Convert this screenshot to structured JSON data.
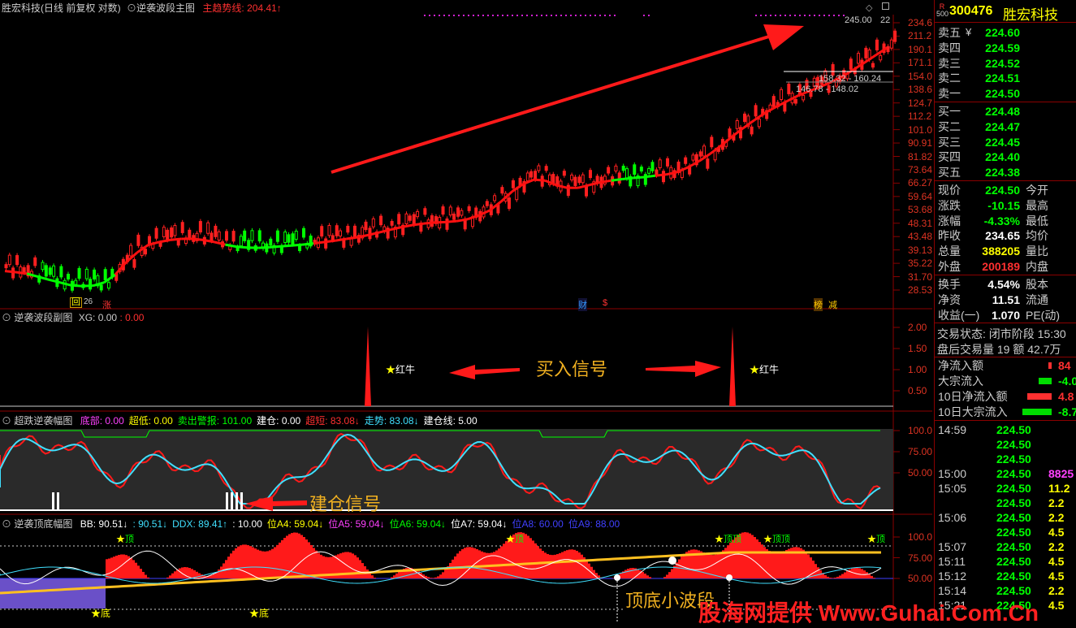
{
  "main": {
    "stock_name": "胜宏科技",
    "period": "(日线 前复权 对数)",
    "indicator": "逆袭波段主图",
    "trend_label": "主趋势线:",
    "trend_value": "204.41",
    "high_price": "245.00",
    "right_top_label": "22",
    "range_labels": [
      "158.32 - 160.24",
      "146.78 - 148.02"
    ],
    "y_ticks": [
      "234.6",
      "211.2",
      "190.1",
      "171.1",
      "154.0",
      "138.6",
      "124.7",
      "112.2",
      "101.0",
      "90.91",
      "81.82",
      "73.64",
      "66.27",
      "59.64",
      "53.68",
      "48.31",
      "43.48",
      "39.13",
      "35.22",
      "31.70",
      "28.53"
    ],
    "event_markers": [
      "回",
      "26",
      "涨",
      "财",
      "$",
      "榜",
      "减"
    ]
  },
  "sub1": {
    "title": "逆袭波段副图",
    "xg_label": "XG: 0.00",
    "xg_value": ": 0.00",
    "signal_label": "红牛",
    "annotation": "买入信号",
    "y_ticks": [
      "2.00",
      "1.50",
      "1.00",
      "0.50"
    ]
  },
  "sub2": {
    "title": "超跌逆袭幅图",
    "legend": [
      {
        "text": "底部: 0.00",
        "color": "#ff40ff"
      },
      {
        "text": "超低: 0.00",
        "color": "#ffff00"
      },
      {
        "text": "卖出警报: 101.00",
        "color": "#00ff00"
      },
      {
        "text": "建仓: 0.00",
        "color": "#ffffff"
      },
      {
        "text": "超短: 83.08↓",
        "color": "#ff3030"
      },
      {
        "text": "走势: 83.08↓",
        "color": "#40e0ff"
      },
      {
        "text": "建仓线: 5.00",
        "color": "#ffffff"
      }
    ],
    "annotation": "建仓信号",
    "y_ticks": [
      "100.0",
      "75.00",
      "50.00"
    ]
  },
  "sub3": {
    "title": "逆袭顶底幅图",
    "legend": [
      {
        "text": "BB: 90.51↓",
        "color": "#ffffff"
      },
      {
        "text": ": 90.51↓",
        "color": "#40e0ff"
      },
      {
        "text": "DDX: 89.41↑",
        "color": "#40e0ff"
      },
      {
        "text": ": 10.00",
        "color": "#ffffff"
      },
      {
        "text": "位A4: 59.04↓",
        "color": "#ffff00"
      },
      {
        "text": "位A5: 59.04↓",
        "color": "#ff40ff"
      },
      {
        "text": "位A6: 59.04↓",
        "color": "#00ff00"
      },
      {
        "text": "位A7: 59.04↓",
        "color": "#ffffff"
      },
      {
        "text": "位A8: 60.00",
        "color": "#4040ff"
      },
      {
        "text": "位A9: 88.00",
        "color": "#4040ff"
      }
    ],
    "labels_top": [
      "顶",
      "顶",
      "顶顶",
      "顶顶",
      "顶"
    ],
    "labels_bottom": [
      "底",
      "底"
    ],
    "annotation": "顶底小波段",
    "y_ticks": [
      "100.0",
      "75.00",
      "50.00"
    ]
  },
  "watermark": "股海网提供 Www.Guhai.Com.Cn",
  "panel": {
    "r_badge": "R",
    "r_num": "500",
    "code": "300476",
    "name": "胜宏科技",
    "asks": [
      {
        "label": "卖五",
        "price": "224.60"
      },
      {
        "label": "卖四",
        "price": "224.59"
      },
      {
        "label": "卖三",
        "price": "224.52"
      },
      {
        "label": "卖二",
        "price": "224.51"
      },
      {
        "label": "卖一",
        "price": "224.50"
      }
    ],
    "ask_unit": "¥",
    "bids": [
      {
        "label": "买一",
        "price": "224.48"
      },
      {
        "label": "买二",
        "price": "224.47"
      },
      {
        "label": "买三",
        "price": "224.45"
      },
      {
        "label": "买四",
        "price": "224.40"
      },
      {
        "label": "买五",
        "price": "224.38"
      }
    ],
    "stats": [
      {
        "l": "现价",
        "v": "224.50",
        "vc": "#00ff00",
        "r": "今开"
      },
      {
        "l": "涨跌",
        "v": "-10.15",
        "vc": "#00ff00",
        "r": "最高"
      },
      {
        "l": "涨幅",
        "v": "-4.33%",
        "vc": "#00ff00",
        "r": "最低"
      },
      {
        "l": "昨收",
        "v": "234.65",
        "vc": "#ffffff",
        "r": "均价"
      },
      {
        "l": "总量",
        "v": "388205",
        "vc": "#ffff00",
        "r": "量比"
      },
      {
        "l": "外盘",
        "v": "200189",
        "vc": "#ff3030",
        "r": "内盘"
      }
    ],
    "stats2": [
      {
        "l": "换手",
        "v": "4.54%",
        "vc": "#ffffff",
        "r": "股本"
      },
      {
        "l": "净资",
        "v": "11.51",
        "vc": "#ffffff",
        "r": "流通"
      },
      {
        "l": "收益(一)",
        "v": "1.070",
        "vc": "#ffffff",
        "r": "PE(动)"
      }
    ],
    "trade_status": "交易状态: 闭市阶段 15:30",
    "after_volume": "盘后交易量 19 额 42.7万",
    "flows": [
      {
        "l": "净流入额",
        "v": "84",
        "vc": "#ff3030",
        "bar": "#ff3030",
        "bw": 4
      },
      {
        "l": "大宗流入",
        "v": "-4.0",
        "vc": "#00ff00",
        "bar": "#00dd00",
        "bw": 16
      },
      {
        "l": "10日净流入额",
        "v": "4.8",
        "vc": "#ff3030",
        "bar": "#ff3030",
        "bw": 30
      },
      {
        "l": "10日大宗流入",
        "v": "-8.7",
        "vc": "#00ff00",
        "bar": "#00dd00",
        "bw": 36
      }
    ],
    "ticks": [
      {
        "t": "14:59",
        "p": "224.50",
        "v": ""
      },
      {
        "t": "",
        "p": "224.50",
        "v": ""
      },
      {
        "t": "",
        "p": "224.50",
        "v": ""
      },
      {
        "t": "15:00",
        "p": "224.50",
        "v": "8825"
      },
      {
        "t": "15:05",
        "p": "224.50",
        "v": "11.2"
      },
      {
        "t": "",
        "p": "224.50",
        "v": "2.2"
      },
      {
        "t": "15:06",
        "p": "224.50",
        "v": "2.2"
      },
      {
        "t": "",
        "p": "224.50",
        "v": "4.5"
      },
      {
        "t": "15:07",
        "p": "224.50",
        "v": "2.2"
      },
      {
        "t": "15:11",
        "p": "224.50",
        "v": "4.5"
      },
      {
        "t": "15:12",
        "p": "224.50",
        "v": "4.5"
      },
      {
        "t": "15:14",
        "p": "224.50",
        "v": "2.2"
      },
      {
        "t": "15:21",
        "p": "224.50",
        "v": "4.5"
      }
    ]
  },
  "chart_data": {
    "type": "line",
    "series": [
      {
        "values": [
          34.5,
          34.2,
          33.8,
          33.0,
          32.2,
          31.5,
          30.8,
          30.6,
          30.7,
          31.5,
          33.5,
          37.0,
          40.0,
          42.5,
          43.5,
          44.2,
          44.6,
          44.6,
          44.2,
          43.5,
          42.6,
          41.9,
          41.6,
          41.5,
          41.7,
          42.0,
          42.3,
          42.6,
          43.0,
          43.5,
          44.0,
          44.6,
          45.2,
          46.0,
          47.0,
          48.0,
          49.0,
          49.8,
          50.4,
          50.8,
          51.0,
          51.4,
          52.2,
          53.8,
          56.0,
          60.0,
          65.0,
          69.0,
          71.5,
          71.0,
          68.5,
          67.0,
          67.0,
          68.5,
          70.0,
          71.0,
          71.8,
          72.5,
          73.0,
          73.8,
          74.5,
          76.0,
          79.0,
          83.0,
          88.0,
          94.0,
          101.0,
          108.0,
          115.0,
          122.0,
          128.0,
          134.0,
          140.0,
          145.0,
          150.0,
          156.0,
          163.0,
          172.0,
          182.0,
          193.0,
          204.4
        ]
      }
    ],
    "ylim": [
      28.53,
      245.0
    ]
  }
}
